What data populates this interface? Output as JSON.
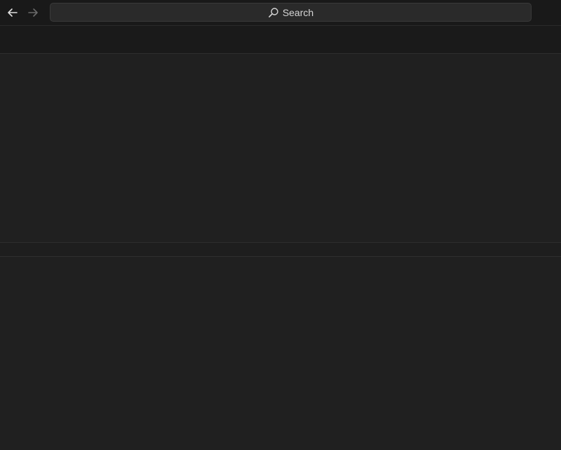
{
  "titlebar": {
    "back_icon": "arrow-left-icon",
    "forward_icon": "arrow-right-icon",
    "search": {
      "label": "Search",
      "icon": "search-icon"
    }
  },
  "colors": {
    "background": "#1f1f1f",
    "titlebar": "#191919",
    "search_box": "#2a2a2a",
    "text": "#d6d6d6",
    "icon_active": "#e0e0e0",
    "icon_disabled": "#6a6a6a"
  }
}
